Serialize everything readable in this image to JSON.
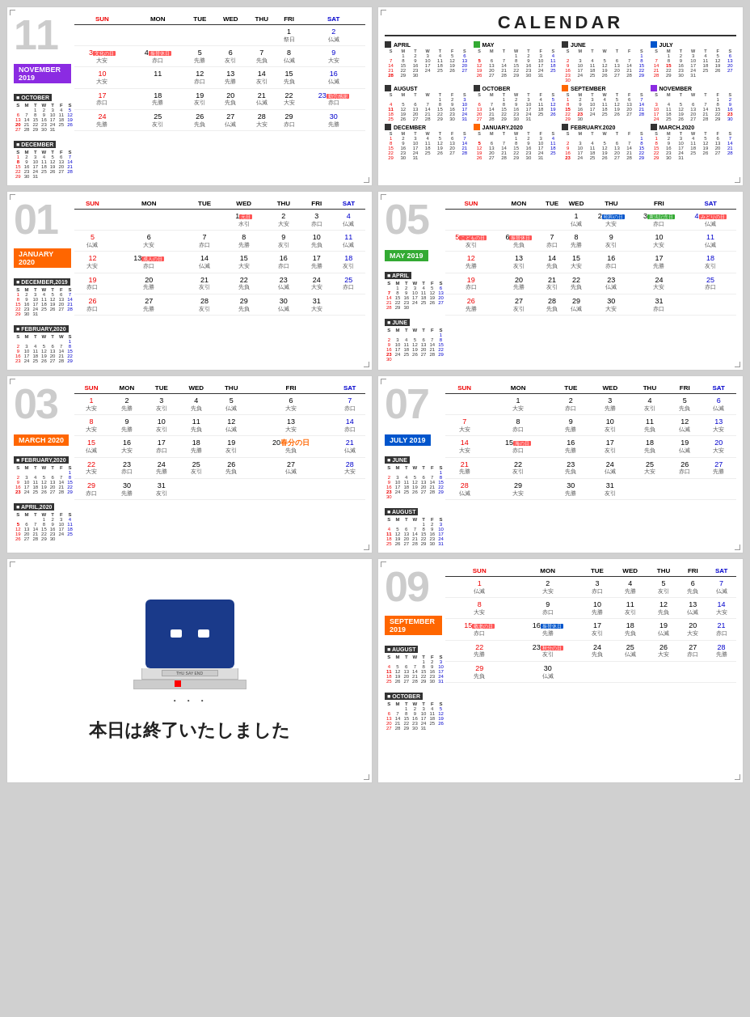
{
  "title": "CALENDAR",
  "panels": {
    "overview_title": "CALENDAR",
    "end_text": "本日は終了いたしました",
    "end_label": "THU SAY END"
  }
}
